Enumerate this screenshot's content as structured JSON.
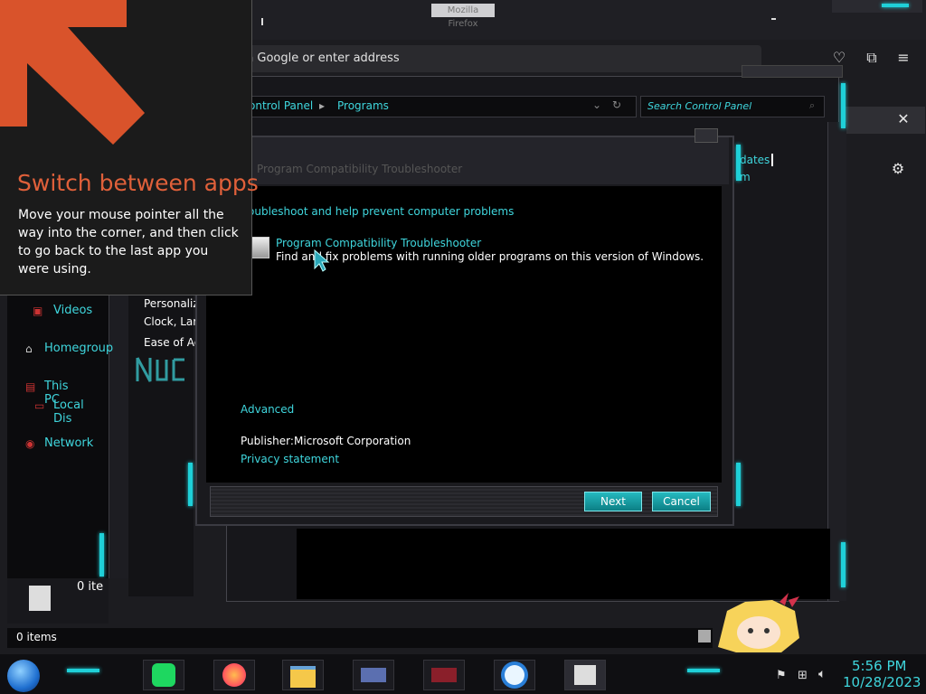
{
  "firefox": {
    "window_title": "Mozilla Firefox",
    "url_placeholder": "Search with Google or enter address",
    "url_visible": "n Google or enter address"
  },
  "control_panel": {
    "breadcrumb": [
      "ontrol Panel",
      "Programs"
    ],
    "search_placeholder": "Search Control Panel",
    "partial_right": [
      "dates",
      "m"
    ]
  },
  "explorer": {
    "nav": [
      {
        "label": "Videos",
        "icon": "video-icon"
      },
      {
        "label": "Homegroup",
        "icon": "homegroup-icon"
      },
      {
        "label": "This PC",
        "icon": "computer-icon"
      },
      {
        "label": "Local Dis",
        "icon": "drive-icon"
      },
      {
        "label": "Network",
        "icon": "network-icon"
      }
    ],
    "middle_items": [
      "Personaliz",
      "Clock, Lar",
      "Ease of Ac"
    ],
    "item_count_partial": "0 ite",
    "status_items": "0 items"
  },
  "dialog": {
    "title": "Program Compatibility Troubleshooter",
    "heading": "oubleshoot and help prevent computer problems",
    "item_title": "Program Compatibility Troubleshooter",
    "item_desc": "Find and fix problems with running older programs on this version of Windows.",
    "advanced": "Advanced",
    "publisher_label": "Publisher:",
    "publisher_value": "Microsoft Corporation",
    "privacy": "Privacy statement",
    "next": "Next",
    "cancel": "Cancel"
  },
  "tip": {
    "title": "Switch between apps",
    "body": "Move your mouse pointer all the way into the corner, and then click to go back to the last app you were using."
  },
  "taskbar": {
    "apps": [
      "spotify-icon",
      "firefox-icon",
      "explorer-icon",
      "control-panel-icon",
      "game-icon",
      "weather-icon",
      "troubleshooter-icon"
    ],
    "time": "5:56 PM",
    "date": "10/28/2023"
  },
  "colors": {
    "accent": "#3fd6dd",
    "tip_title": "#e0603a",
    "arrow": "#d9532b"
  }
}
